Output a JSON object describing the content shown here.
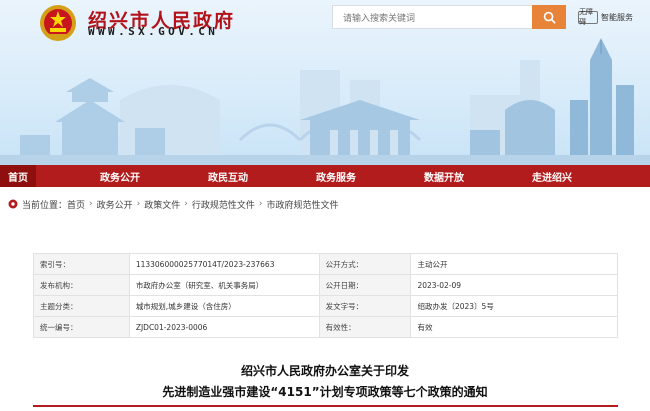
{
  "header": {
    "site_title": "绍兴市人民政府",
    "site_url": "WWW.SX.GOV.CN",
    "search_placeholder": "请输入搜索关键词",
    "accessible_label": "智能服务",
    "accessible_box": "无障碍"
  },
  "nav": {
    "items": [
      {
        "label": "首页",
        "active": true
      },
      {
        "label": "政务公开"
      },
      {
        "label": "政民互动"
      },
      {
        "label": "政务服务"
      },
      {
        "label": "数据开放"
      },
      {
        "label": "走进绍兴"
      }
    ]
  },
  "breadcrumb": {
    "prefix": "当前位置：",
    "items": [
      "首页",
      "政务公开",
      "政策文件",
      "行政规范性文件",
      "市政府规范性文件"
    ]
  },
  "meta": {
    "rows": [
      {
        "l1": "索引号：",
        "v1": "11330600002577014T/2023-237663",
        "l2": "公开方式：",
        "v2": "主动公开"
      },
      {
        "l1": "发布机构：",
        "v1": "市政府办公室（研究室、机关事务局）",
        "l2": "公开日期：",
        "v2": "2023-02-09"
      },
      {
        "l1": "主题分类：",
        "v1": "城市规划,城乡建设（含住房）",
        "l2": "发文字号：",
        "v2": "绍政办发〔2023〕5号"
      },
      {
        "l1": "统一编号：",
        "v1": "ZJDC01-2023-0006",
        "l2": "有效性：",
        "v2": "有效"
      }
    ]
  },
  "document": {
    "title_line1": "绍兴市人民政府办公室关于印发",
    "title_line2": "先进制造业强市建设“4151”计划专项政策等七个政策的通知"
  },
  "colors": {
    "nav_red": "#b21c1c",
    "nav_active": "#8f0f0f",
    "title_red": "#b3121a",
    "search_orange": "#e8833a"
  }
}
